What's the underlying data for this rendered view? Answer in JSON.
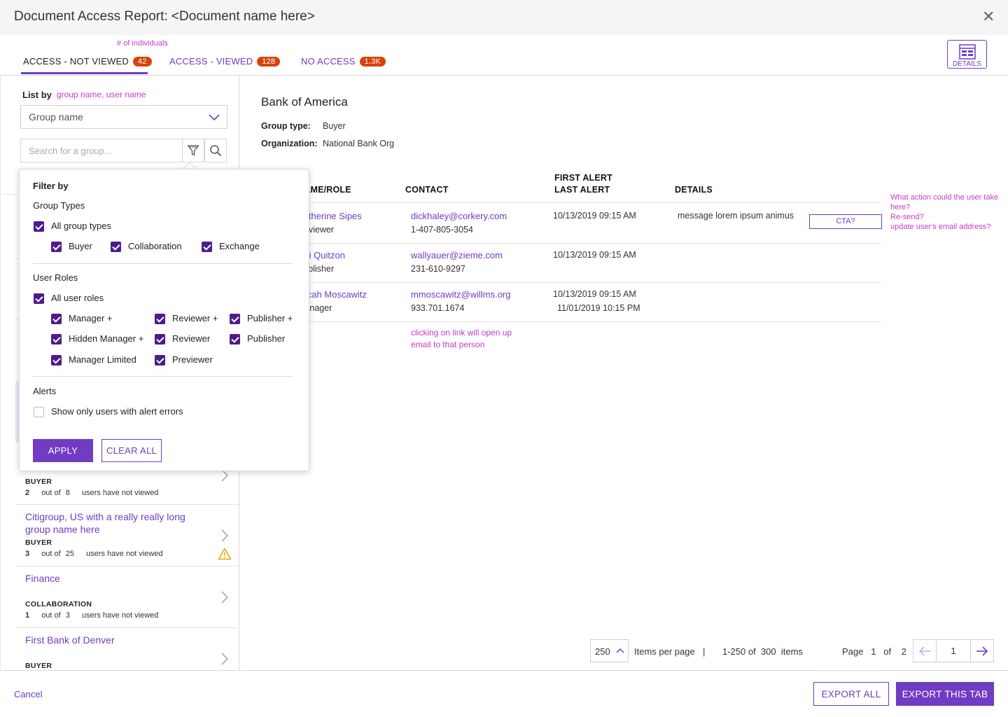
{
  "header": {
    "title": "Document Access Report: <Document name here>",
    "close_symbol": "✕"
  },
  "tabs": [
    {
      "label": "ACCESS - NOT VIEWED",
      "count": "42",
      "active": true
    },
    {
      "label": "ACCESS - VIEWED",
      "count": "128",
      "active": false
    },
    {
      "label": "NO ACCESS",
      "count": "1.3K",
      "active": false
    }
  ],
  "tabs_annotation": "# of individuals",
  "details_button": {
    "label": "DETAILS",
    "icon": "window-icon"
  },
  "left": {
    "list_by_label": "List by",
    "list_by_note": "group name, user name",
    "select_value": "Group name",
    "search_placeholder": "Search for a group...",
    "groups": [
      {
        "name": "",
        "type": "BUYER",
        "count": "2",
        "total": "8",
        "out_of": "out of",
        "suffix": "users have not viewed",
        "warning": false
      },
      {
        "name": "Citigroup, US with a really really long group name here",
        "type": "BUYER",
        "count": "3",
        "total": "25",
        "out_of": "out of",
        "suffix": "users have not viewed",
        "warning": true
      },
      {
        "name": "Finance",
        "type": "COLLABORATION",
        "count": "1",
        "total": "3",
        "out_of": "out of",
        "suffix": "users have not viewed",
        "warning": false
      },
      {
        "name": "First Bank of Denver",
        "type": "BUYER"
      }
    ]
  },
  "filter": {
    "title": "Filter by",
    "group_types_heading": "Group Types",
    "all_group_types": "All group types",
    "group_types": [
      "Buyer",
      "Collaboration",
      "Exchange"
    ],
    "user_roles_heading": "User Roles",
    "all_user_roles": "All user roles",
    "roles": [
      "Manager +",
      "Reviewer +",
      "Publisher +",
      "Hidden Manager +",
      "Reviewer",
      "Publisher",
      "Manager Limited",
      "Previewer"
    ],
    "alerts_heading": "Alerts",
    "alerts_option": "Show only users with alert errors",
    "apply_label": "APPLY",
    "clear_label": "CLEAR ALL"
  },
  "detail": {
    "org_name": "Bank of America",
    "group_type_label": "Group type:",
    "group_type_value": "Buyer",
    "organization_label": "Organization:",
    "organization_value": "National Bank Org",
    "columns": {
      "name_role": "NAME/ROLE",
      "contact": "CONTACT",
      "first_alert": "FIRST ALERT",
      "last_alert": "LAST ALERT",
      "details": "DETAILS"
    },
    "rows": [
      {
        "name": "Katherine Sipes",
        "role": "Reviewer",
        "email": "dickhaley@corkery.com",
        "phone": "1-407-805-3054",
        "first_alert": "10/13/2019 09:15 AM",
        "last_alert": "",
        "details": "message lorem ipsum animus",
        "cta": "CTA?"
      },
      {
        "name": "Rui Quitzon",
        "role": "Publisher",
        "email": "wallyauer@zieme.com",
        "phone": "231-610-9297",
        "first_alert": "10/13/2019 09:15 AM",
        "last_alert": "",
        "details": "",
        "cta": ""
      },
      {
        "name": "Micah Moscawitz",
        "role": "Manager",
        "email": "mmoscawitz@willms.org",
        "phone": "933.701.1674",
        "first_alert": "10/13/2019 09:15 AM",
        "last_alert": "11/01/2019 10:15 PM",
        "details": "",
        "cta": ""
      }
    ],
    "link_note": "clicking on link will open up email to that person",
    "cta_note_1": "What action could the user take here?",
    "cta_note_2": "Re-send?",
    "cta_note_3": "update user's email address?"
  },
  "pagination": {
    "per_page": "250",
    "per_page_label": "Items per page",
    "separator": "|",
    "range": "1-250",
    "of_label": "of",
    "total": "300",
    "items_label": "items",
    "page_label": "Page",
    "current_page": "1",
    "page_of": "of",
    "total_pages": "2",
    "page_input": "1"
  },
  "footer": {
    "cancel": "Cancel",
    "export_all": "EXPORT ALL",
    "export_tab": "EXPORT THIS TAB"
  },
  "colors": {
    "accent": "#6f3cc3",
    "badge": "#d8430d",
    "note": "#c43bc4",
    "checkbox": "#4d1c8c",
    "warning": "#e0a800"
  }
}
